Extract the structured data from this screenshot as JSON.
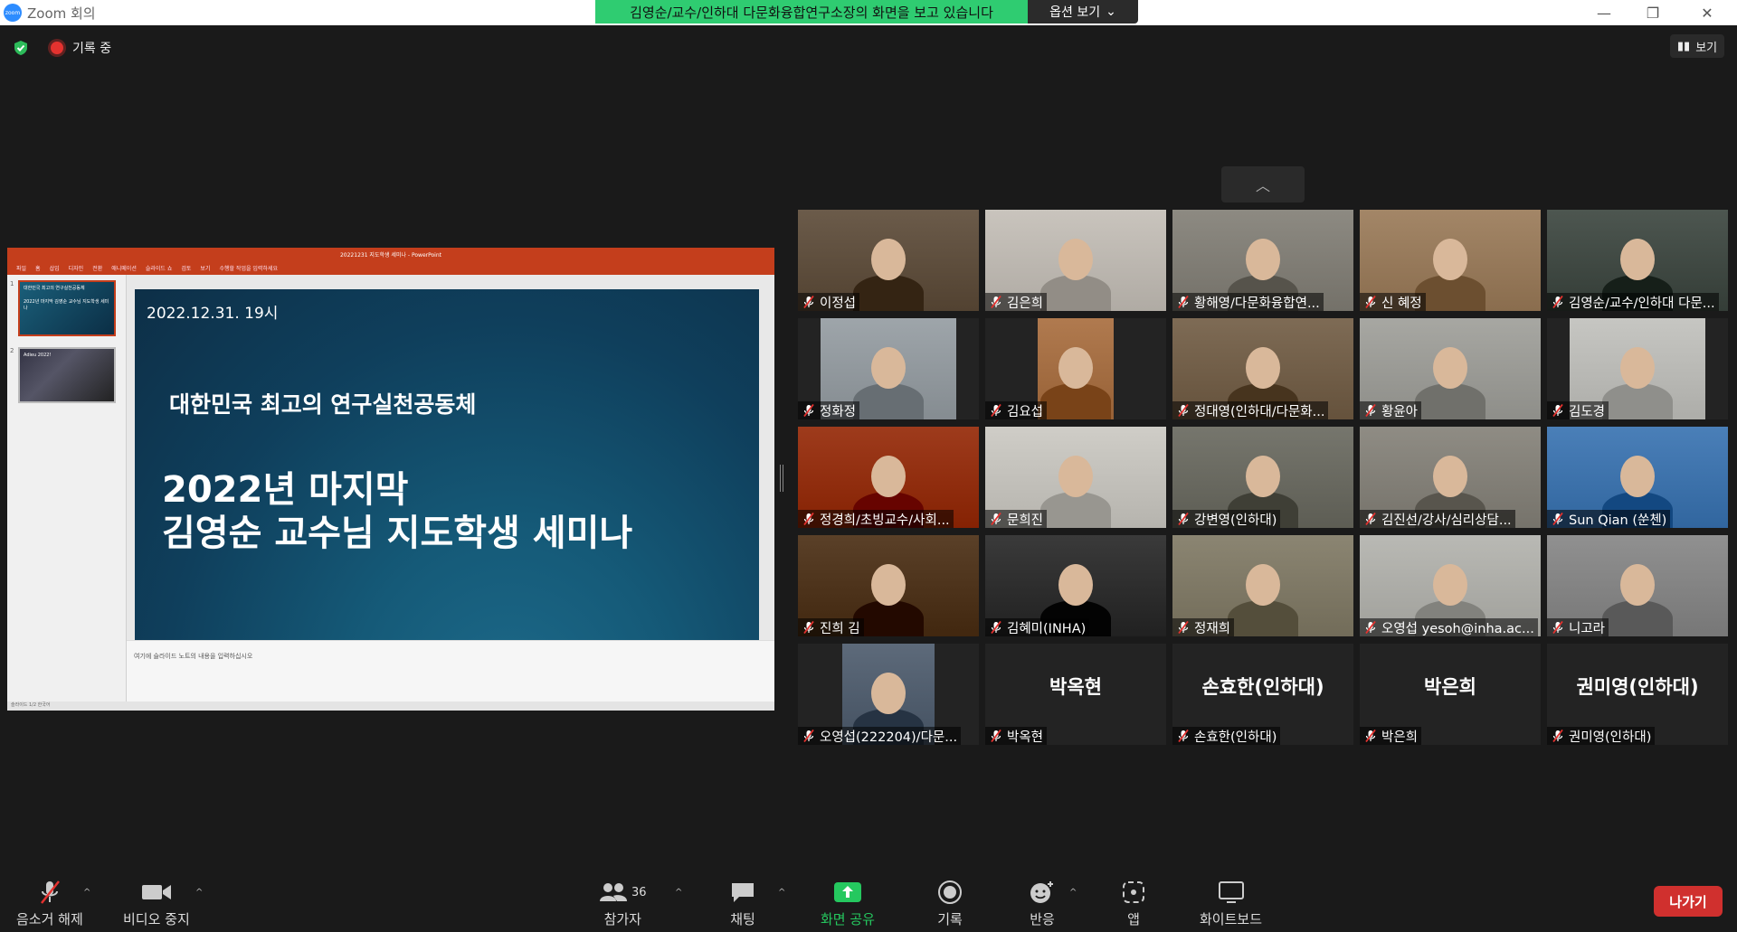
{
  "window": {
    "app_title": "Zoom 회의",
    "share_banner": "김영순/교수/인하대 다문화융합연구소장의 화면을 보고 있습니다",
    "options_label": "옵션 보기"
  },
  "topbar": {
    "recording_label": "기록 중",
    "view_label": "보기"
  },
  "shared_screen": {
    "ppt_filename": "20221231 지도학생 세미나 - PowerPoint",
    "ppt_menu": [
      "파일",
      "홈",
      "삽입",
      "디자인",
      "전환",
      "애니메이션",
      "슬라이드 쇼",
      "검토",
      "보기"
    ],
    "ppt_search": "수행할 작업을 입력하세요",
    "thumb1_text_a": "대한민국 최고의 연구실천공동체",
    "thumb1_text_b": "2022년 마지막 김영순 교수님 지도학생 세미나",
    "thumb2_text": "Adieu 2022!",
    "slide_date": "2022.12.31. 19시",
    "slide_subtitle": "대한민국 최고의 연구실천공동체",
    "slide_title_line1": "2022년 마지막",
    "slide_title_line2": "김영순 교수님 지도학생 세미나",
    "notes_placeholder": "여기에 슬라이드 노트의 내용을 입력하십시오",
    "status_text": "슬라이드 1/2   한국어"
  },
  "participants": [
    {
      "name": "이정섭",
      "bg": "#6b5b4a"
    },
    {
      "name": "김은희",
      "bg": "#c9c4bd"
    },
    {
      "name": "황해영/다문화융합연...",
      "bg": "#8d8a82"
    },
    {
      "name": "신 혜정",
      "bg": "#a38667"
    },
    {
      "name": "김영순/교수/인하대 다문...",
      "bg": "#4d5650",
      "active": true
    },
    {
      "name": "정화정",
      "bg": "#9ea5aa"
    },
    {
      "name": "김요섭",
      "bg": "#b07a4f"
    },
    {
      "name": "정대영(인하대/다문화...",
      "bg": "#7e6b55"
    },
    {
      "name": "황윤아",
      "bg": "#a7a7a2"
    },
    {
      "name": "김도경",
      "bg": "#c6c6c2"
    },
    {
      "name": "정경희/초빙교수/사회...",
      "bg": "#9e3b1c"
    },
    {
      "name": "문희진",
      "bg": "#cfcdc7"
    },
    {
      "name": "강변영(인하대)",
      "bg": "#76766d"
    },
    {
      "name": "김진선/강사/심리상담...",
      "bg": "#8f8c84"
    },
    {
      "name": "Sun Qian (쑨첸)",
      "bg": "#4a7fb8"
    },
    {
      "name": "진희 김",
      "bg": "#5a4028"
    },
    {
      "name": "김혜미(INHA)",
      "bg": "#3a3a3a"
    },
    {
      "name": "정재희",
      "bg": "#8b8572"
    },
    {
      "name": "오영섭 yesoh@inha.ac...",
      "bg": "#b9b9b4"
    },
    {
      "name": "니고라",
      "bg": "#909090"
    },
    {
      "name": "오영섭(222204)/다문...",
      "bg": "#5d6a7a"
    },
    {
      "name": "박옥현",
      "big": "박옥현"
    },
    {
      "name": "손효한(인하대)",
      "big": "손효한(인하대)"
    },
    {
      "name": "박은희",
      "big": "박은희"
    },
    {
      "name": "권미영(인하대)",
      "big": "권미영(인하대)"
    }
  ],
  "toolbar": {
    "unmute": "음소거 해제",
    "stop_video": "비디오 중지",
    "participants": "참가자",
    "participant_count": "36",
    "chat": "채팅",
    "share_screen": "화면 공유",
    "record": "기록",
    "reactions": "반응",
    "apps": "앱",
    "whiteboard": "화이트보드",
    "leave": "나가기"
  },
  "colors": {
    "share_banner": "#2fcc71",
    "leave": "#d0302e",
    "active_speaker": "#c7e75a",
    "ppt_accent": "#c43e1c"
  }
}
